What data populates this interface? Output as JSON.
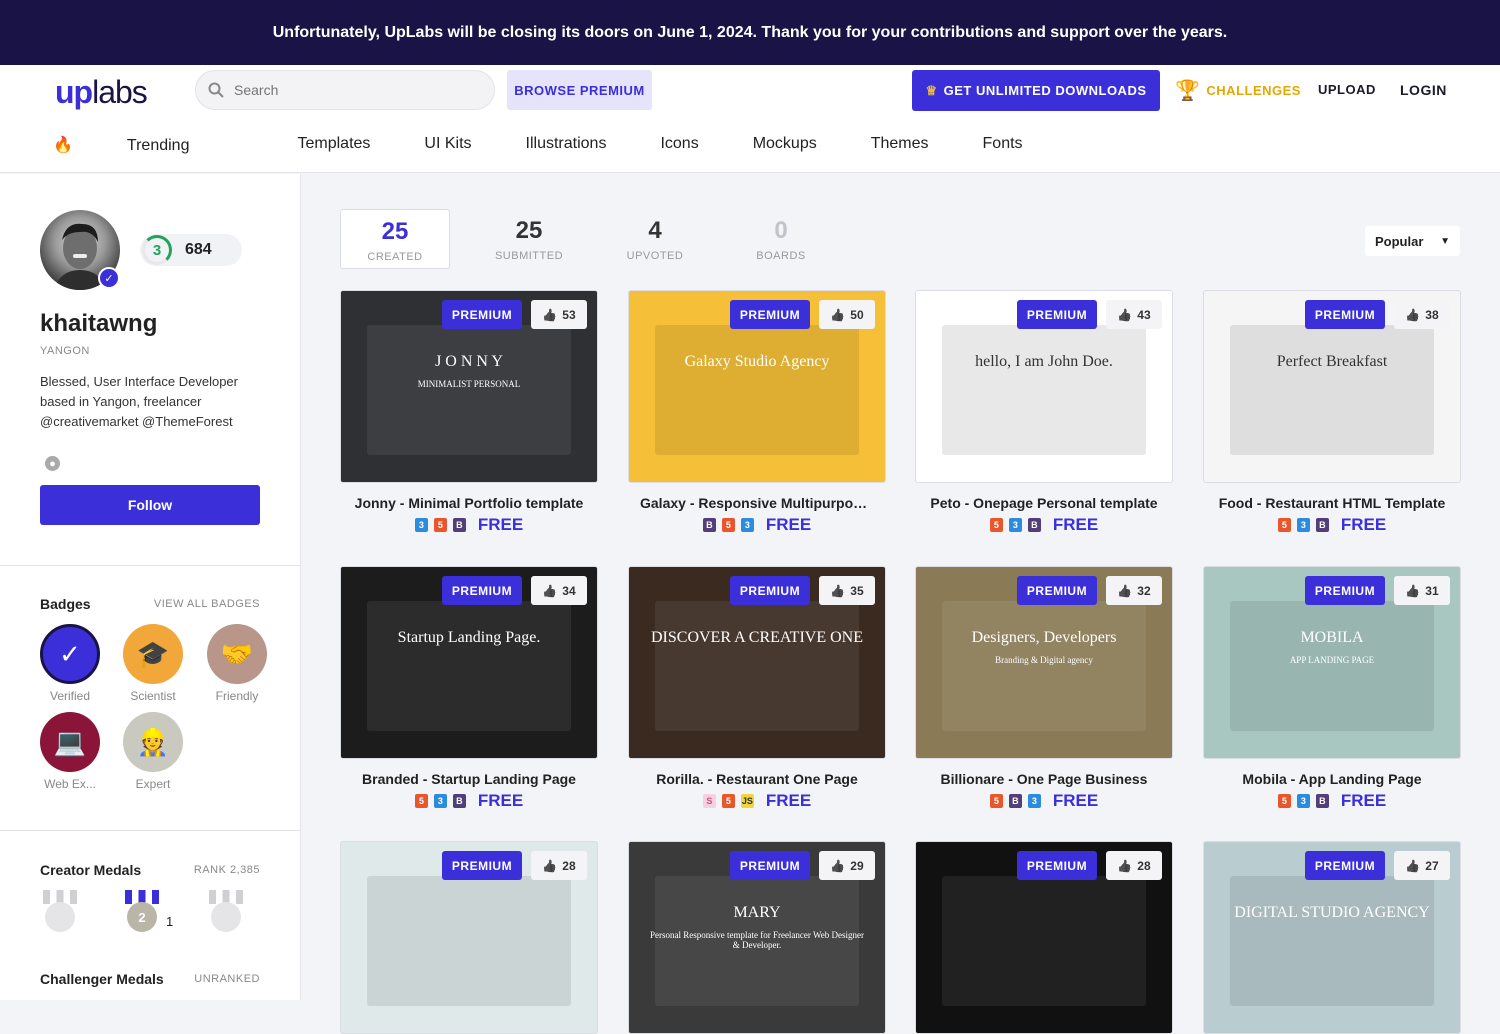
{
  "banner": "Unfortunately, UpLabs will be closing its doors on June 1, 2024. Thank you for your contributions and support over the years.",
  "logo": {
    "part1": "up",
    "part2": "labs"
  },
  "search": {
    "placeholder": "Search"
  },
  "header": {
    "browse_premium": "BROWSE PREMIUM",
    "get_unlimited": "GET UNLIMITED DOWNLOADS",
    "challenges": "CHALLENGES",
    "upload": "UPLOAD",
    "login": "LOGIN"
  },
  "categories": [
    "Trending",
    "Templates",
    "UI Kits",
    "Illustrations",
    "Icons",
    "Mockups",
    "Themes",
    "Fonts"
  ],
  "profile": {
    "level": "3",
    "points": "684",
    "username": "khaitawng",
    "location": "YANGON",
    "bio": "Blessed, User Interface Developer based in Yangon, freelancer @creativemarket @ThemeForest",
    "follow": "Follow"
  },
  "badges": {
    "title": "Badges",
    "view_all": "VIEW ALL BADGES",
    "items": [
      {
        "label": "Verified",
        "icon": "check-icon",
        "color": "#3b2fd9"
      },
      {
        "label": "Scientist",
        "icon": "graduation-cap-icon",
        "color": "#f2a73b"
      },
      {
        "label": "Friendly",
        "icon": "handshake-icon",
        "color": "#b8968a"
      },
      {
        "label": "Web Ex...",
        "icon": "developer-icon",
        "color": "#8a1538"
      },
      {
        "label": "Expert",
        "icon": "expert-icon",
        "color": "#c9c9c0"
      }
    ]
  },
  "creator_medals": {
    "title": "Creator Medals",
    "rank": "RANK 2,385",
    "silver_count": "1"
  },
  "challenger_medals": {
    "title": "Challenger Medals",
    "rank": "UNRANKED"
  },
  "stats": [
    {
      "value": "25",
      "label": "CREATED"
    },
    {
      "value": "25",
      "label": "SUBMITTED"
    },
    {
      "value": "4",
      "label": "UPVOTED"
    },
    {
      "value": "0",
      "label": "BOARDS"
    }
  ],
  "sort": {
    "value": "Popular"
  },
  "premium_label": "PREMIUM",
  "free_label": "FREE",
  "cards": [
    {
      "title": "Jonny - Minimal Portfolio template",
      "likes": "53",
      "tech": [
        "css3",
        "html5",
        "bootstrap"
      ],
      "thumb_text": "J O N N Y",
      "thumb_sub": "MINIMALIST PERSONAL",
      "bg": "#2f3033"
    },
    {
      "title": "Galaxy - Responsive Multipurpose t...",
      "likes": "50",
      "tech": [
        "bootstrap",
        "html5",
        "css3"
      ],
      "thumb_text": "Galaxy Studio Agency",
      "thumb_sub": "",
      "bg": "#f5c038"
    },
    {
      "title": "Peto - Onepage Personal template",
      "likes": "43",
      "tech": [
        "html5",
        "css3",
        "bootstrap"
      ],
      "thumb_text": "hello, I am John Doe.",
      "thumb_sub": "",
      "bg": "#ffffff"
    },
    {
      "title": "Food - Restaurant HTML Template",
      "likes": "38",
      "tech": [
        "html5",
        "css3",
        "bootstrap"
      ],
      "thumb_text": "Perfect Breakfast",
      "thumb_sub": "",
      "bg": "#f5f5f5"
    },
    {
      "title": "Branded - Startup Landing Page",
      "likes": "34",
      "tech": [
        "html5",
        "css3",
        "bootstrap"
      ],
      "thumb_text": "Startup Landing Page.",
      "thumb_sub": "",
      "bg": "#1c1c1c"
    },
    {
      "title": "Rorilla. - Restaurant One Page",
      "likes": "35",
      "tech": [
        "sass",
        "html5",
        "js"
      ],
      "thumb_text": "DISCOVER A CREATIVE ONE",
      "thumb_sub": "",
      "bg": "#3a2a20"
    },
    {
      "title": "Billionare - One Page Business",
      "likes": "32",
      "tech": [
        "html5",
        "bootstrap",
        "css3"
      ],
      "thumb_text": "Designers, Developers",
      "thumb_sub": "Branding & Digital agency",
      "bg": "#8a7a55"
    },
    {
      "title": "Mobila - App Landing Page",
      "likes": "31",
      "tech": [
        "html5",
        "css3",
        "bootstrap"
      ],
      "thumb_text": "MOBILA",
      "thumb_sub": "APP LANDING PAGE",
      "bg": "#a9c7c1"
    },
    {
      "title": "",
      "likes": "28",
      "tech": [],
      "thumb_text": "",
      "thumb_sub": "",
      "bg": "#dfe9ea"
    },
    {
      "title": "",
      "likes": "29",
      "tech": [],
      "thumb_text": "MARY",
      "thumb_sub": "Personal Responsive template for Freelancer Web Designer & Developer.",
      "bg": "#3a3a3a"
    },
    {
      "title": "",
      "likes": "28",
      "tech": [],
      "thumb_text": "",
      "thumb_sub": "",
      "bg": "#111111"
    },
    {
      "title": "",
      "likes": "27",
      "tech": [],
      "thumb_text": "DIGITAL STUDIO AGENCY",
      "thumb_sub": "",
      "bg": "#b9cdd0"
    }
  ],
  "colors": {
    "accent": "#3b2fd9",
    "banner_bg": "#1a1446",
    "challenges": "#e6a800"
  }
}
